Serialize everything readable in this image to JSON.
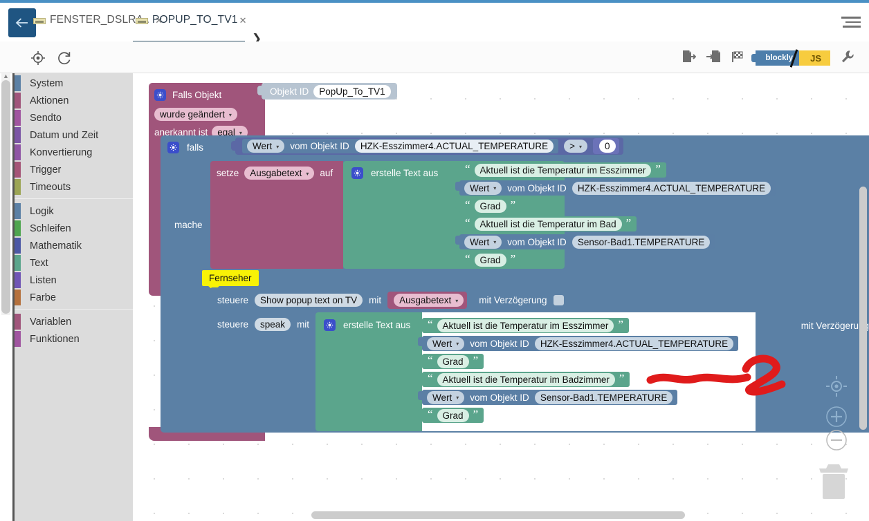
{
  "window": {
    "back_icon": "back-arrow-icon",
    "menu_icon": "hamburger-menu-icon",
    "next_tab_icon": "chevron-right-icon"
  },
  "tabs": [
    {
      "label": "FENSTER_DSLRA..",
      "close": "✕",
      "active": false,
      "icon": "script-file-icon"
    },
    {
      "label": "POPUP_TO_TV1",
      "close": "✕",
      "active": true,
      "icon": "script-file-icon"
    }
  ],
  "toolbar": {
    "target_icon": "crosshair-target-icon",
    "reload_icon": "reload-icon",
    "export_icon": "export-blocks-icon",
    "import_icon": "import-blocks-icon",
    "checkered_icon": "checkered-flag-icon",
    "wrench_icon": "wrench-settings-icon",
    "blockly_label": "blockly",
    "js_label": "JS"
  },
  "sidebar": {
    "groups": [
      {
        "items": [
          {
            "label": "System",
            "color": "#5b80a5"
          },
          {
            "label": "Aktionen",
            "color": "#a0557b"
          },
          {
            "label": "Sendto",
            "color": "#a055a0"
          },
          {
            "label": "Datum und Zeit",
            "color": "#7b55a5"
          },
          {
            "label": "Konvertierung",
            "color": "#8f55a5"
          },
          {
            "label": "Trigger",
            "color": "#a55577"
          },
          {
            "label": "Timeouts",
            "color": "#9ca555"
          }
        ]
      },
      {
        "items": [
          {
            "label": "Logik",
            "color": "#5b80a5"
          },
          {
            "label": "Schleifen",
            "color": "#4fa54f"
          },
          {
            "label": "Mathematik",
            "color": "#4c58a5"
          },
          {
            "label": "Text",
            "color": "#5ba58c"
          },
          {
            "label": "Listen",
            "color": "#7055b5"
          },
          {
            "label": "Farbe",
            "color": "#b5713d"
          }
        ]
      },
      {
        "items": [
          {
            "label": "Variablen",
            "color": "#a0557b"
          },
          {
            "label": "Funktionen",
            "color": "#a055a0"
          }
        ]
      }
    ]
  },
  "workspace": {
    "event_block": {
      "gear_icon": "gear-icon",
      "title": "Falls Objekt",
      "trigger_mode": "wurde geändert",
      "ack_label": "anerkannt ist",
      "ack_value": "egal",
      "objid_label": "Objekt ID",
      "objid_value": "PopUp_To_TV1",
      "color": "#a0557b"
    },
    "if_block": {
      "gear_icon": "gear-icon",
      "if_label": "falls",
      "do_label": "mache",
      "color": "#5b80a5"
    },
    "condition": {
      "value_dropdown": "Wert",
      "from_object_label": "vom Objekt ID",
      "object_id": "HZK-Esszimmer4.ACTUAL_TEMPERATURE",
      "operator": ">",
      "number": "0",
      "color": "#5b68a5"
    },
    "set_variable": {
      "set_label": "setze",
      "variable": "Ausgabetext",
      "to_label": "auf",
      "color": "#a0557b"
    },
    "create_text_1": {
      "gear_icon": "gear-icon",
      "title": "erstelle Text aus",
      "color": "#5ba58c",
      "rows": [
        {
          "kind": "text",
          "value": "Aktuell ist die Temperatur im Esszimmer"
        },
        {
          "kind": "value",
          "dropdown": "Wert",
          "from_object_label": "vom Objekt ID",
          "object_id": "HZK-Esszimmer4.ACTUAL_TEMPERATURE"
        },
        {
          "kind": "text",
          "value": "Grad"
        },
        {
          "kind": "text",
          "value": "Aktuell ist die Temperatur im Bad"
        },
        {
          "kind": "value",
          "dropdown": "Wert",
          "from_object_label": "vom Objekt ID",
          "object_id": "Sensor-Bad1.TEMPERATURE"
        },
        {
          "kind": "text",
          "value": "Grad"
        }
      ]
    },
    "comment_label": "Fernseher",
    "control_1": {
      "control_label": "steuere",
      "target": "Show popup text on TV",
      "with_label": "mit",
      "variable": "Ausgabetext",
      "delay_label": "mit Verzögerung",
      "color": "#5b80a5"
    },
    "control_2": {
      "control_label": "steuere",
      "target": "speak",
      "with_label": "mit",
      "delay_label": "mit Verzögerung",
      "color": "#5b80a5"
    },
    "create_text_2": {
      "gear_icon": "gear-icon",
      "title": "erstelle Text aus",
      "color": "#5ba58c",
      "rows": [
        {
          "kind": "text",
          "value": "Aktuell ist die Temperatur im Esszimmer"
        },
        {
          "kind": "value",
          "dropdown": "Wert",
          "from_object_label": "vom Objekt ID",
          "object_id": "HZK-Esszimmer4.ACTUAL_TEMPERATURE"
        },
        {
          "kind": "text",
          "value": "Grad"
        },
        {
          "kind": "text",
          "value": "Aktuell ist die Temperatur im Badzimmer"
        },
        {
          "kind": "value",
          "dropdown": "Wert",
          "from_object_label": "vom Objekt ID",
          "object_id": "Sensor-Bad1.TEMPERATURE"
        },
        {
          "kind": "text",
          "value": "Grad"
        }
      ]
    },
    "annotation": {
      "shape": "red-squiggle-arrow",
      "color": "#e01b1b"
    },
    "controls": {
      "center_icon": "center-workspace-icon",
      "zoom_in_icon": "zoom-in-icon",
      "zoom_out_icon": "zoom-out-icon",
      "trash_icon": "trash-icon"
    }
  }
}
